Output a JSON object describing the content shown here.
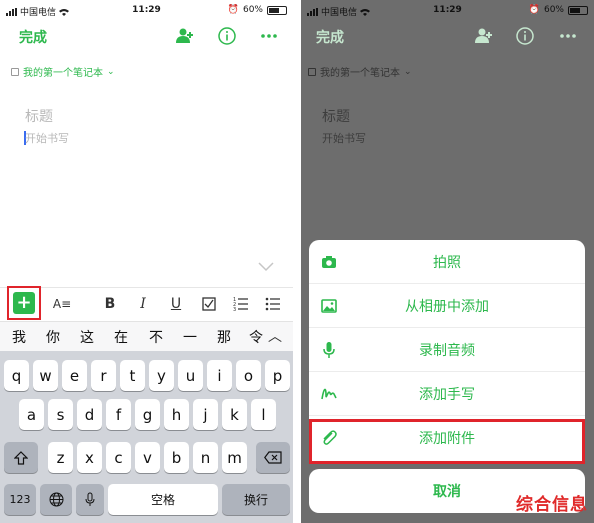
{
  "status": {
    "carrier": "中国电信",
    "time": "11:29",
    "battery": "60%",
    "battery_level": 0.6
  },
  "navbar": {
    "done_label": "完成"
  },
  "notebook": {
    "name": "我的第一个笔记本"
  },
  "editor": {
    "title_placeholder": "标题",
    "body_placeholder": "开始书写"
  },
  "toolbar": {
    "add": "+",
    "text_style": "A≡",
    "bold": "B",
    "italic": "I",
    "underline": "U"
  },
  "candidates": [
    "我",
    "你",
    "这",
    "在",
    "不",
    "一",
    "那",
    "令"
  ],
  "keyboard": {
    "row1": [
      "q",
      "w",
      "e",
      "r",
      "t",
      "y",
      "u",
      "i",
      "o",
      "p"
    ],
    "row2": [
      "a",
      "s",
      "d",
      "f",
      "g",
      "h",
      "j",
      "k",
      "l"
    ],
    "row3": [
      "z",
      "x",
      "c",
      "v",
      "b",
      "n",
      "m"
    ],
    "numbers": "123",
    "space": "空格",
    "return": "换行"
  },
  "sheet": {
    "items": [
      {
        "label": "拍照",
        "icon": "camera-icon"
      },
      {
        "label": "从相册中添加",
        "icon": "image-icon"
      },
      {
        "label": "录制音频",
        "icon": "microphone-icon"
      },
      {
        "label": "添加手写",
        "icon": "handwriting-icon"
      },
      {
        "label": "添加附件",
        "icon": "paperclip-icon"
      }
    ],
    "cancel": "取消"
  },
  "watermark": "综合信息",
  "colors": {
    "accent": "#2db84d",
    "highlight": "#e0242b"
  }
}
